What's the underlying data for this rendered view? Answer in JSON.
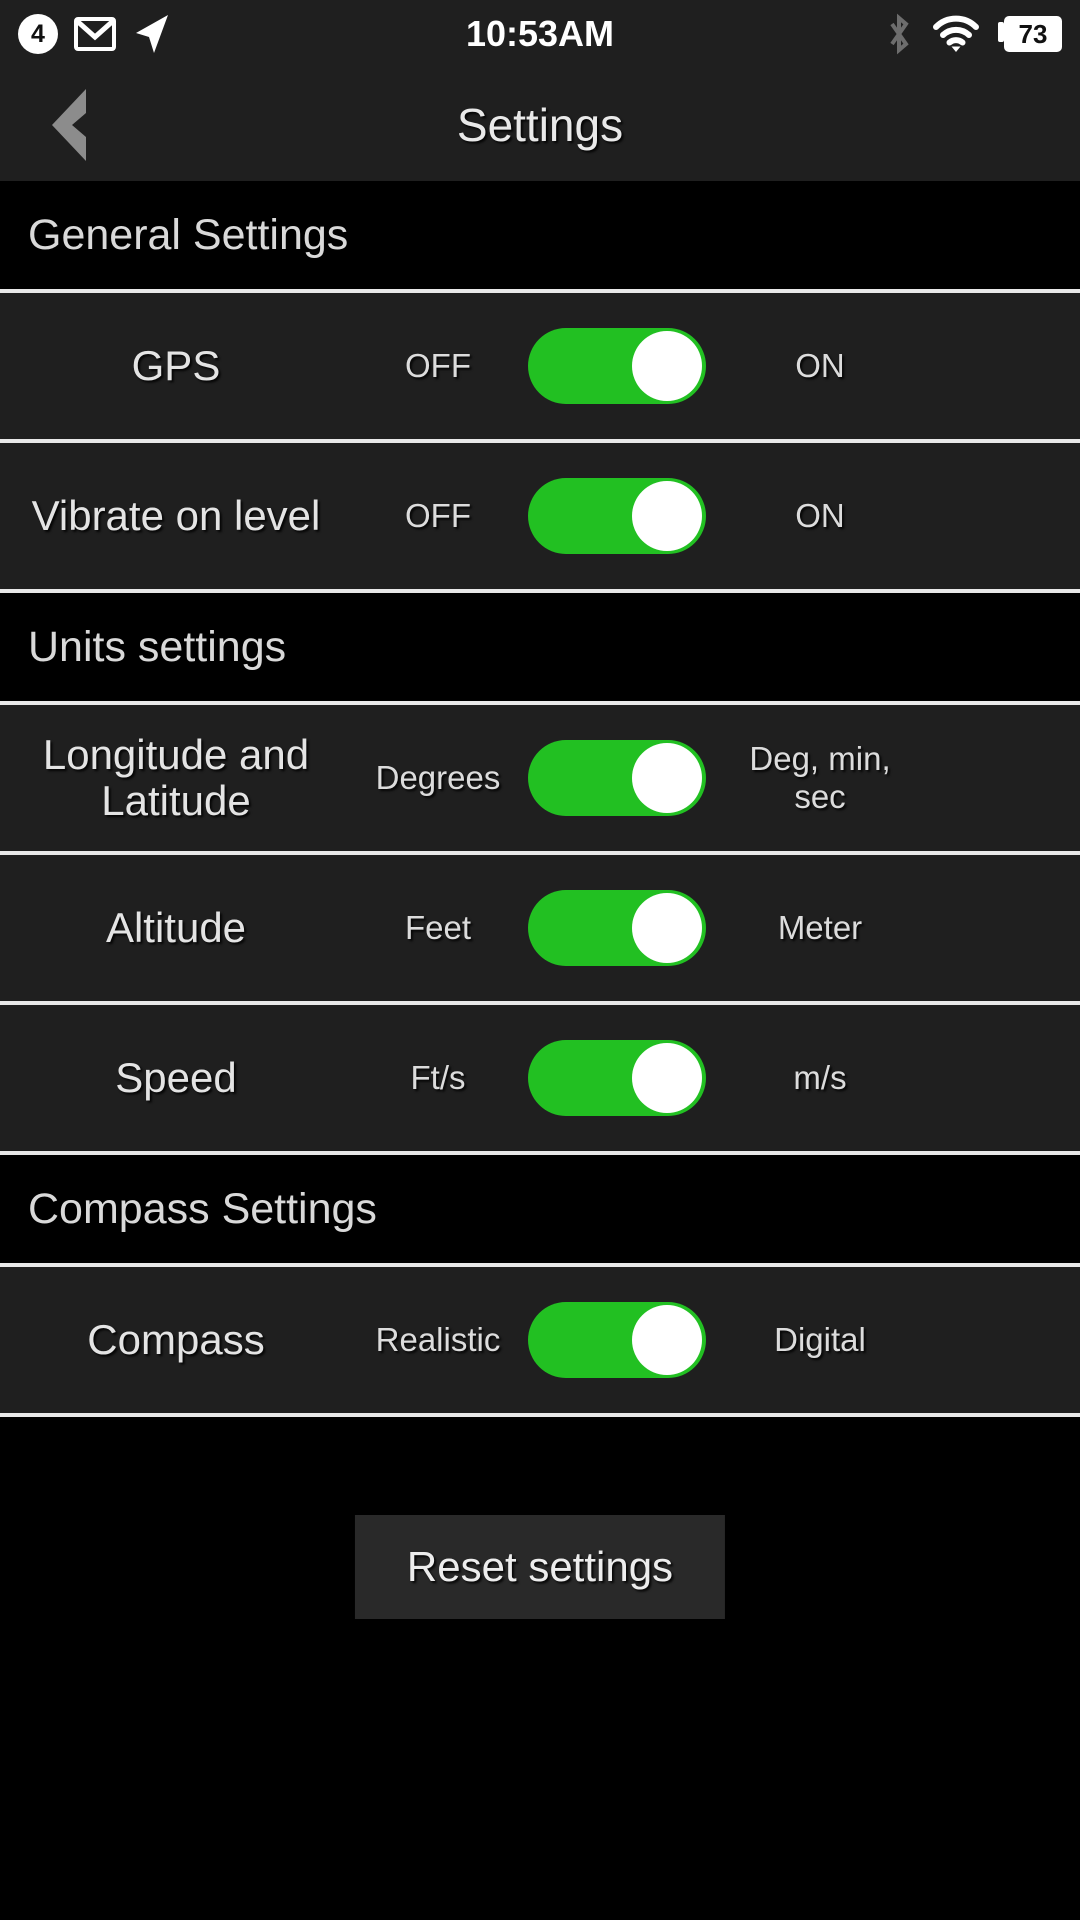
{
  "status_bar": {
    "notification_count": "4",
    "time": "10:53AM",
    "battery_level": "73",
    "icons": {
      "notification_badge": "notification-count-badge",
      "mail": "mail-icon",
      "location": "location-arrow-icon",
      "bluetooth": "bluetooth-icon",
      "wifi": "wifi-icon",
      "battery": "battery-icon"
    }
  },
  "header": {
    "title": "Settings",
    "back_icon": "chevron-left-icon"
  },
  "sections": [
    {
      "title": "General Settings",
      "rows": [
        {
          "label": "GPS",
          "left_option": "OFF",
          "right_option": "ON",
          "state": "right"
        },
        {
          "label": "Vibrate on level",
          "left_option": "OFF",
          "right_option": "ON",
          "state": "right"
        }
      ]
    },
    {
      "title": "Units settings",
      "rows": [
        {
          "label": "Longitude and Latitude",
          "left_option": "Degrees",
          "right_option": "Deg, min, sec",
          "state": "right"
        },
        {
          "label": "Altitude",
          "left_option": "Feet",
          "right_option": "Meter",
          "state": "right"
        },
        {
          "label": "Speed",
          "left_option": "Ft/s",
          "right_option": "m/s",
          "state": "right"
        }
      ]
    },
    {
      "title": "Compass Settings",
      "rows": [
        {
          "label": "Compass",
          "left_option": "Realistic",
          "right_option": "Digital",
          "state": "right"
        }
      ]
    }
  ],
  "footer": {
    "reset_label": "Reset settings"
  },
  "colors": {
    "toggle_on": "#22c022",
    "knob": "#ffffff",
    "row_background": "#1f1f1f",
    "section_background": "#000000",
    "separator": "#e8e8e8",
    "text": "#e4e4e4"
  }
}
